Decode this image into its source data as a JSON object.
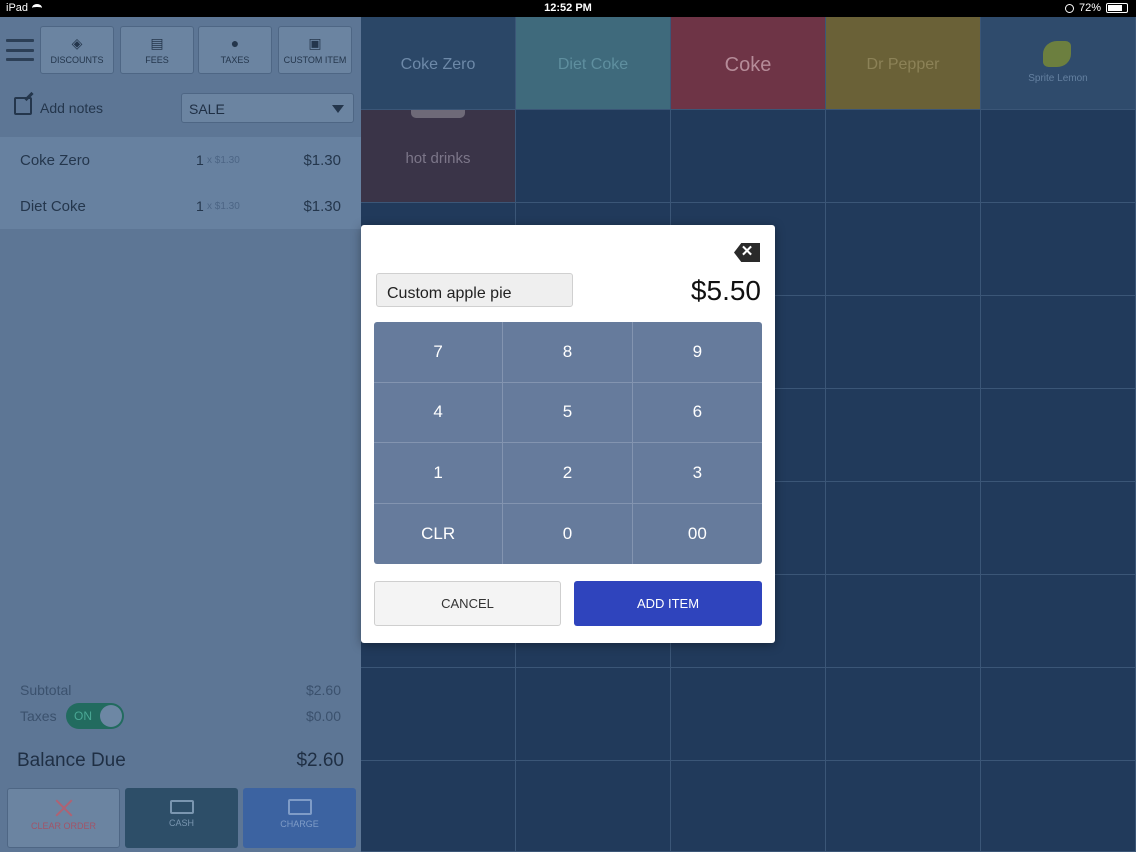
{
  "status_bar": {
    "device": "iPad",
    "time": "12:52 PM",
    "battery": "72%"
  },
  "toolbar": {
    "discounts": "DISCOUNTS",
    "fees": "FEES",
    "taxes": "TAXES",
    "custom_item": "CUSTOM ITEM"
  },
  "notes": {
    "label": "Add notes"
  },
  "sale_type": {
    "selected": "SALE"
  },
  "order": [
    {
      "name": "Coke Zero",
      "qty": "1",
      "unit": "x $1.30",
      "total": "$1.30"
    },
    {
      "name": "Diet Coke",
      "qty": "1",
      "unit": "x $1.30",
      "total": "$1.30"
    }
  ],
  "totals": {
    "subtotal_label": "Subtotal",
    "subtotal_value": "$2.60",
    "taxes_label": "Taxes",
    "taxes_toggle": "ON",
    "taxes_value": "$0.00",
    "balance_label": "Balance Due",
    "balance_value": "$2.60"
  },
  "bottom_buttons": {
    "clear": "CLEAR ORDER",
    "cash": "CASH",
    "charge": "CHARGE"
  },
  "products": {
    "coke_zero": "Coke Zero",
    "diet_coke": "Diet Coke",
    "coke": "Coke",
    "dr_pepper": "Dr Pepper",
    "sprite_lemon": "Sprite Lemon",
    "hot_drinks": "hot drinks"
  },
  "colors": {
    "coke_zero": "#2b4767",
    "diet_coke": "#3f6a7c",
    "coke": "#6e3446",
    "dr_pepper": "#6a6137",
    "sprite_lemon": "#2f4b6c",
    "hot_drinks": "#3a3448",
    "add_item": "#2f44bd"
  },
  "modal": {
    "item_name": "Custom apple pie",
    "price": "$5.50",
    "keys": [
      "7",
      "8",
      "9",
      "4",
      "5",
      "6",
      "1",
      "2",
      "3",
      "CLR",
      "0",
      "00"
    ],
    "cancel": "CANCEL",
    "add_item": "ADD ITEM"
  }
}
